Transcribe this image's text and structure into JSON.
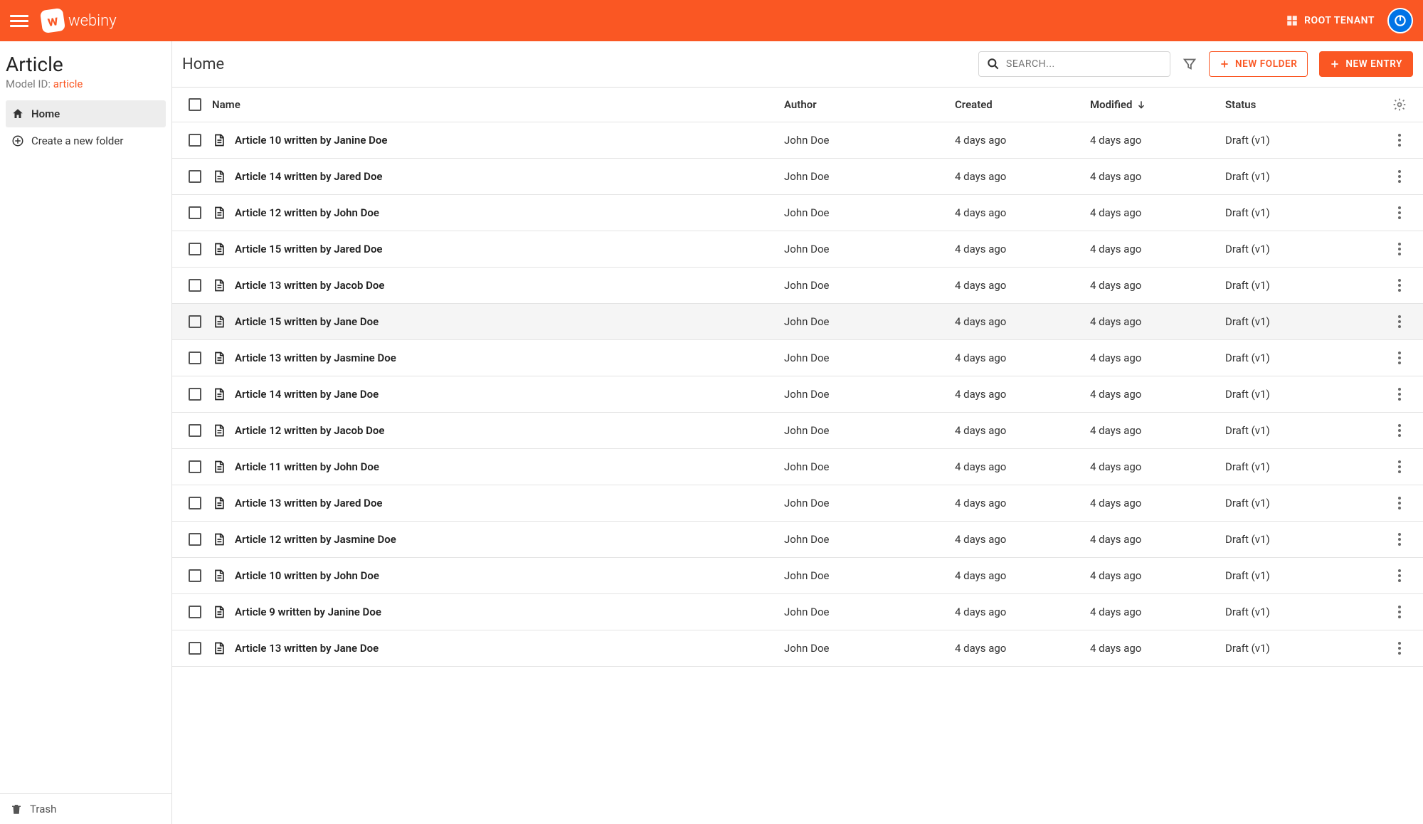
{
  "header": {
    "logo_text": "webiny",
    "tenant_label": "ROOT TENANT"
  },
  "sidebar": {
    "title": "Article",
    "model_id_label": "Model ID:",
    "model_id": "article",
    "home": "Home",
    "create_folder": "Create a new folder",
    "trash": "Trash"
  },
  "toolbar": {
    "breadcrumb": "Home",
    "search_placeholder": "SEARCH...",
    "new_folder": "NEW FOLDER",
    "new_entry": "NEW ENTRY"
  },
  "columns": {
    "name": "Name",
    "author": "Author",
    "created": "Created",
    "modified": "Modified",
    "status": "Status"
  },
  "rows": [
    {
      "name": "Article 10 written by Janine Doe",
      "author": "John Doe",
      "created": "4 days ago",
      "modified": "4 days ago",
      "status": "Draft (v1)",
      "hover": false
    },
    {
      "name": "Article 14 written by Jared Doe",
      "author": "John Doe",
      "created": "4 days ago",
      "modified": "4 days ago",
      "status": "Draft (v1)",
      "hover": false
    },
    {
      "name": "Article 12 written by John Doe",
      "author": "John Doe",
      "created": "4 days ago",
      "modified": "4 days ago",
      "status": "Draft (v1)",
      "hover": false
    },
    {
      "name": "Article 15 written by Jared Doe",
      "author": "John Doe",
      "created": "4 days ago",
      "modified": "4 days ago",
      "status": "Draft (v1)",
      "hover": false
    },
    {
      "name": "Article 13 written by Jacob Doe",
      "author": "John Doe",
      "created": "4 days ago",
      "modified": "4 days ago",
      "status": "Draft (v1)",
      "hover": false
    },
    {
      "name": "Article 15 written by Jane Doe",
      "author": "John Doe",
      "created": "4 days ago",
      "modified": "4 days ago",
      "status": "Draft (v1)",
      "hover": true
    },
    {
      "name": "Article 13 written by Jasmine Doe",
      "author": "John Doe",
      "created": "4 days ago",
      "modified": "4 days ago",
      "status": "Draft (v1)",
      "hover": false
    },
    {
      "name": "Article 14 written by Jane Doe",
      "author": "John Doe",
      "created": "4 days ago",
      "modified": "4 days ago",
      "status": "Draft (v1)",
      "hover": false
    },
    {
      "name": "Article 12 written by Jacob Doe",
      "author": "John Doe",
      "created": "4 days ago",
      "modified": "4 days ago",
      "status": "Draft (v1)",
      "hover": false
    },
    {
      "name": "Article 11 written by John Doe",
      "author": "John Doe",
      "created": "4 days ago",
      "modified": "4 days ago",
      "status": "Draft (v1)",
      "hover": false
    },
    {
      "name": "Article 13 written by Jared Doe",
      "author": "John Doe",
      "created": "4 days ago",
      "modified": "4 days ago",
      "status": "Draft (v1)",
      "hover": false
    },
    {
      "name": "Article 12 written by Jasmine Doe",
      "author": "John Doe",
      "created": "4 days ago",
      "modified": "4 days ago",
      "status": "Draft (v1)",
      "hover": false
    },
    {
      "name": "Article 10 written by John Doe",
      "author": "John Doe",
      "created": "4 days ago",
      "modified": "4 days ago",
      "status": "Draft (v1)",
      "hover": false
    },
    {
      "name": "Article 9 written by Janine Doe",
      "author": "John Doe",
      "created": "4 days ago",
      "modified": "4 days ago",
      "status": "Draft (v1)",
      "hover": false
    },
    {
      "name": "Article 13 written by Jane Doe",
      "author": "John Doe",
      "created": "4 days ago",
      "modified": "4 days ago",
      "status": "Draft (v1)",
      "hover": false
    }
  ]
}
